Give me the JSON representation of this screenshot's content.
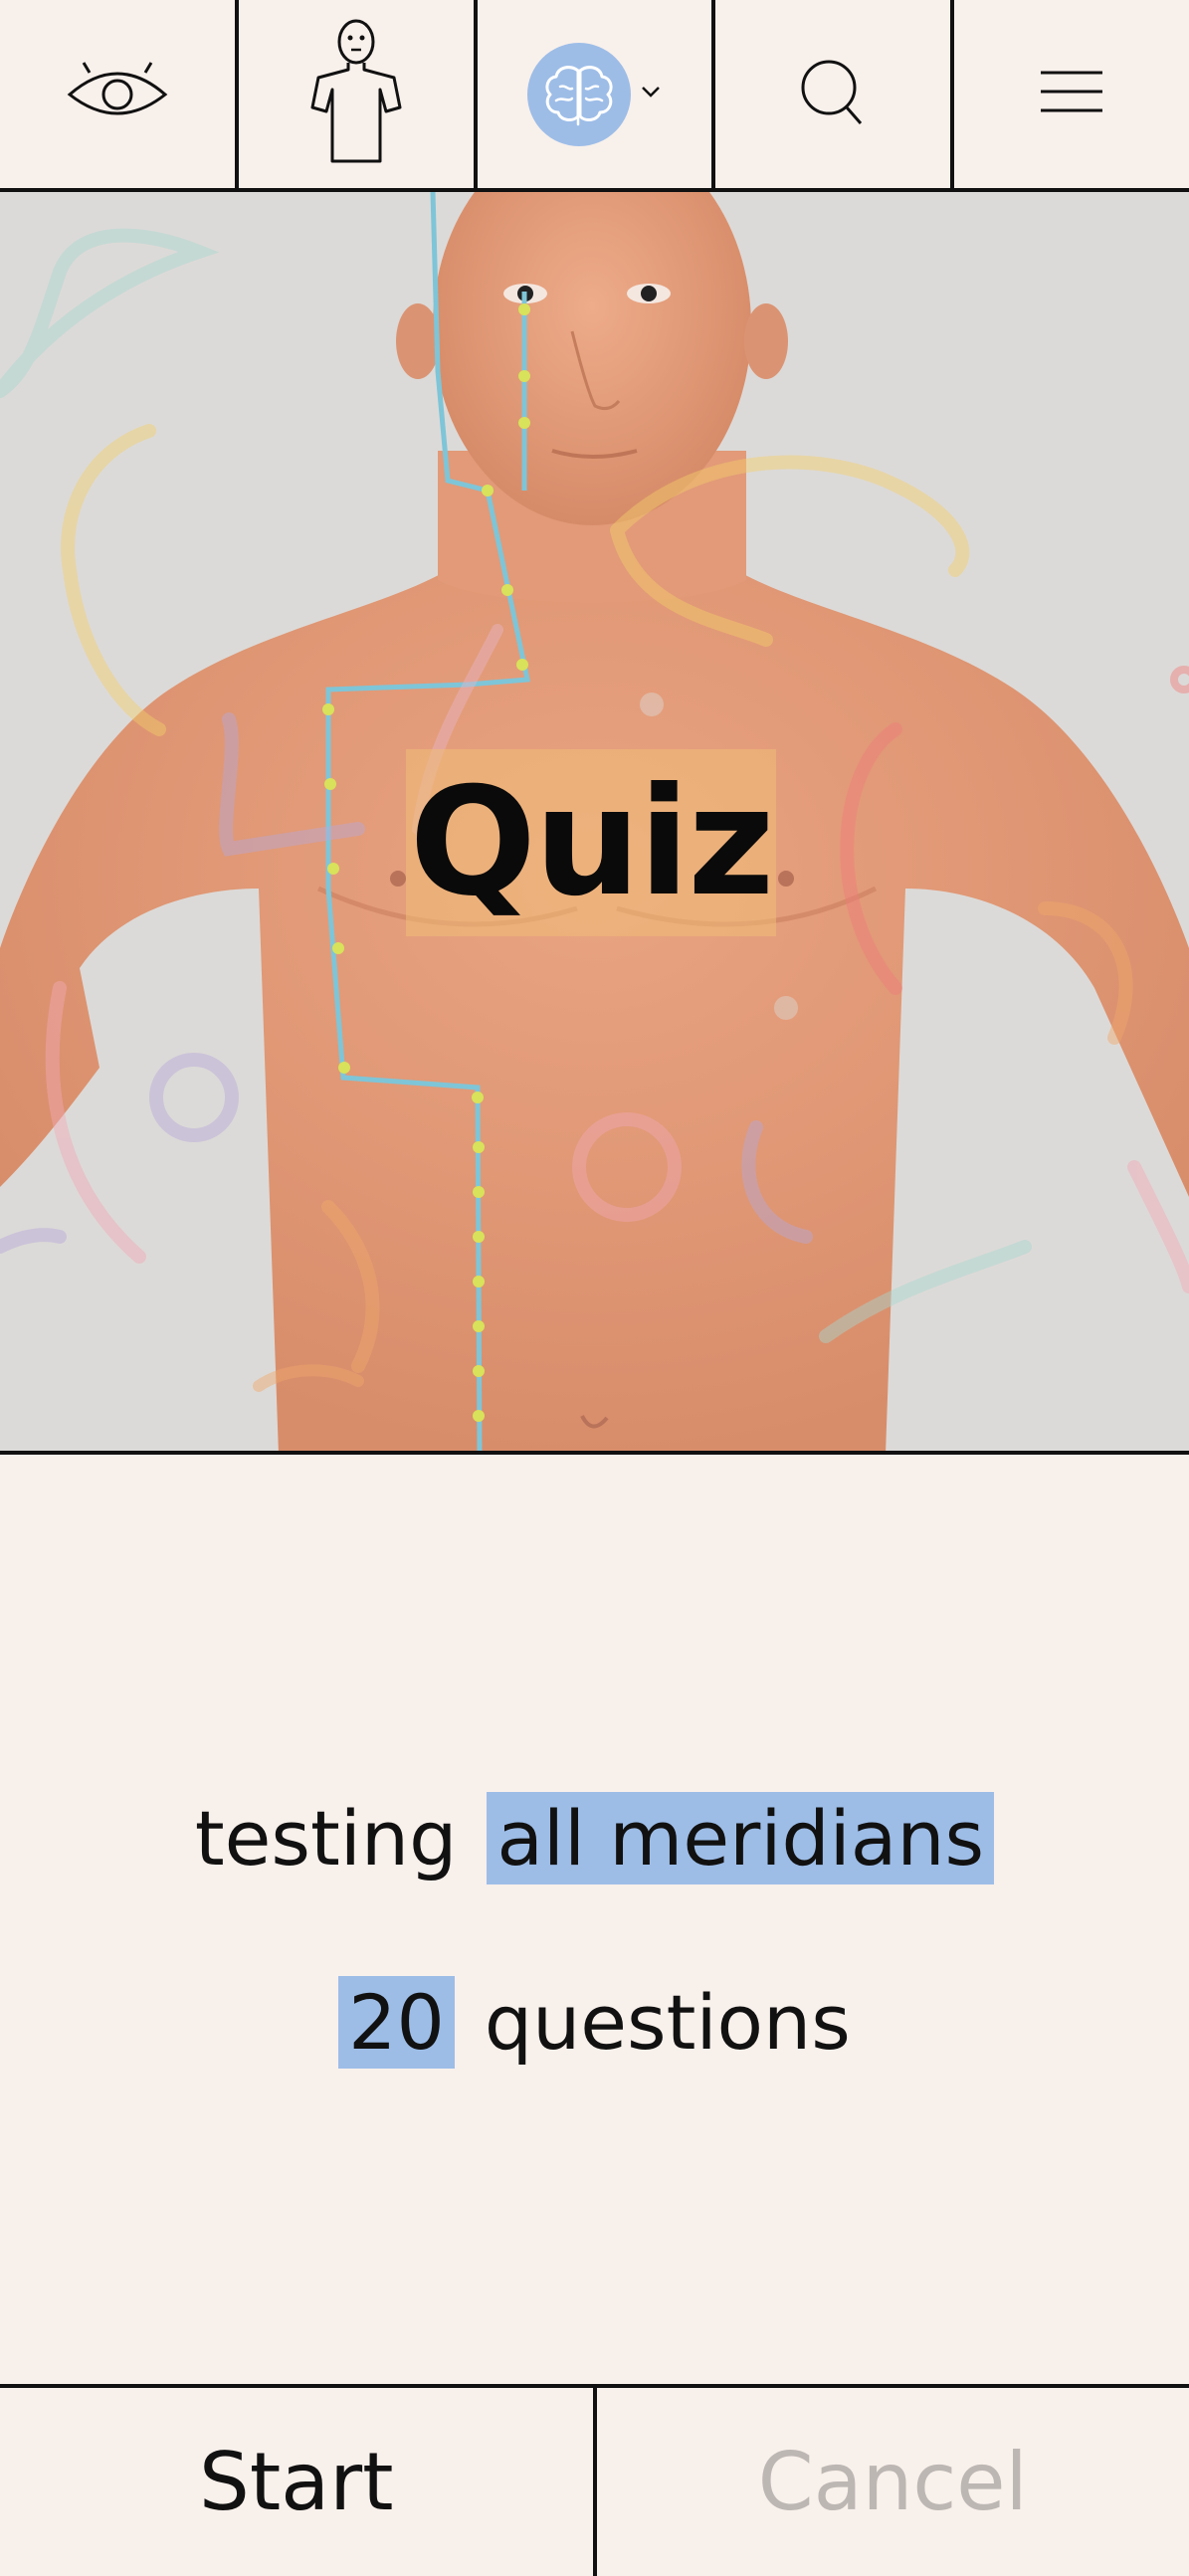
{
  "topbar": {
    "items": [
      {
        "name": "view-eye-icon"
      },
      {
        "name": "body-model-icon"
      },
      {
        "name": "brain-icon",
        "active": true
      },
      {
        "name": "search-icon"
      },
      {
        "name": "hamburger-menu-icon"
      }
    ]
  },
  "hero": {
    "title": "Quiz"
  },
  "settings": {
    "prefix": "testing",
    "meridian_selection": "all meridians",
    "question_count": "20",
    "suffix": "questions"
  },
  "actions": {
    "start_label": "Start",
    "cancel_label": "Cancel"
  },
  "colors": {
    "background": "#f8f0eb",
    "accent_blue": "#9dbde7",
    "border": "#111111",
    "disabled_text": "#bdb7b3",
    "meridian_line": "#7ec5d8"
  }
}
